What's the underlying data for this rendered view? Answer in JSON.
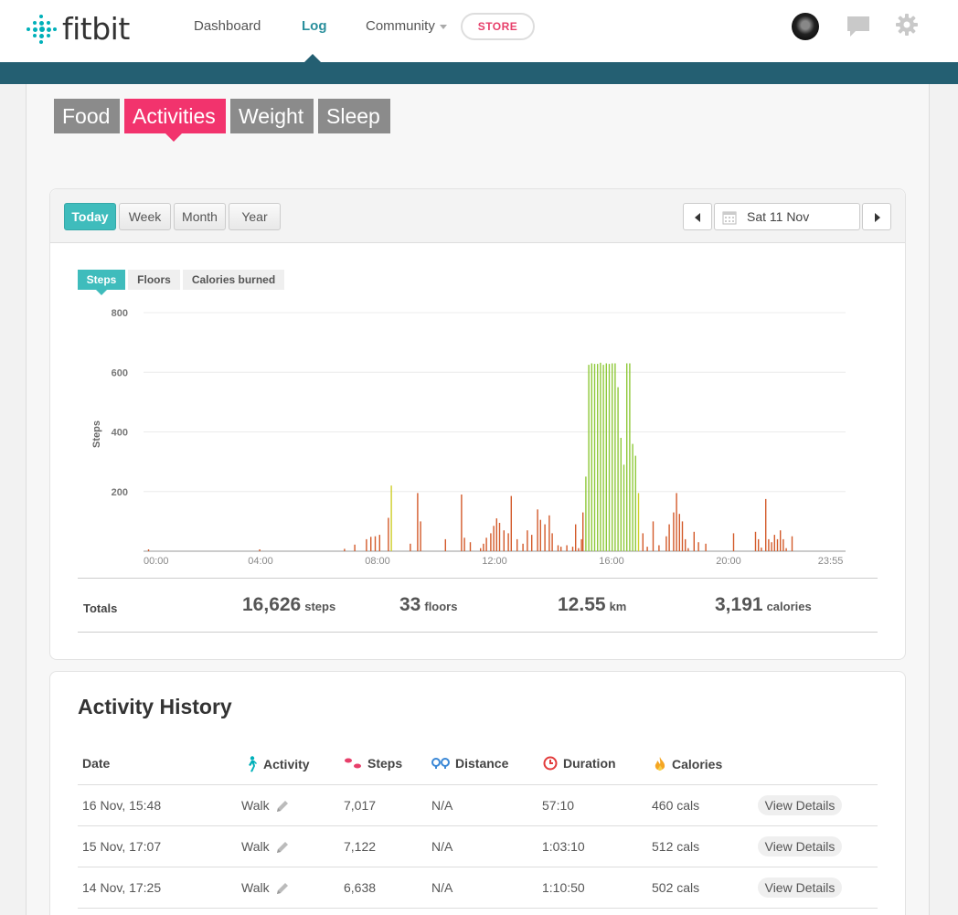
{
  "brand": {
    "name": "fitbit",
    "accent": "#00b0b9"
  },
  "nav": {
    "links": [
      "Dashboard",
      "Log",
      "Community"
    ],
    "store": "STORE",
    "icons": [
      "avatar",
      "chat-icon",
      "gear-icon"
    ]
  },
  "log_tabs": [
    "Food",
    "Activities",
    "Weight",
    "Sleep"
  ],
  "range_tabs": [
    "Today",
    "Week",
    "Month",
    "Year"
  ],
  "date_picker": {
    "value": "Sat 11 Nov"
  },
  "metric_tabs": [
    "Steps",
    "Floors",
    "Calories burned"
  ],
  "chart_data": {
    "type": "bar",
    "ylabel": "Steps",
    "ylim": [
      0,
      800
    ],
    "yticks": [
      "200",
      "400",
      "600",
      "800"
    ],
    "xticks": [
      "00:00",
      "04:00",
      "08:00",
      "12:00",
      "16:00",
      "20:00",
      "23:55"
    ],
    "colors": {
      "low": "#d35a2a",
      "mid": "#cfcf2a",
      "high": "#8fc93a"
    },
    "bars_time_value": [
      [
        0.15,
        6
      ],
      [
        3.95,
        6
      ],
      [
        6.85,
        8
      ],
      [
        7.2,
        22
      ],
      [
        7.6,
        40
      ],
      [
        7.75,
        48
      ],
      [
        7.9,
        50
      ],
      [
        8.05,
        55
      ],
      [
        8.35,
        112
      ],
      [
        8.45,
        220
      ],
      [
        9.1,
        25
      ],
      [
        9.35,
        195
      ],
      [
        9.45,
        100
      ],
      [
        10.3,
        40
      ],
      [
        10.85,
        190
      ],
      [
        10.95,
        45
      ],
      [
        11.15,
        30
      ],
      [
        11.5,
        10
      ],
      [
        11.6,
        25
      ],
      [
        11.7,
        45
      ],
      [
        11.85,
        60
      ],
      [
        11.95,
        85
      ],
      [
        12.05,
        110
      ],
      [
        12.15,
        95
      ],
      [
        12.3,
        70
      ],
      [
        12.45,
        60
      ],
      [
        12.55,
        185
      ],
      [
        12.75,
        40
      ],
      [
        12.95,
        25
      ],
      [
        13.1,
        70
      ],
      [
        13.25,
        55
      ],
      [
        13.45,
        140
      ],
      [
        13.55,
        105
      ],
      [
        13.7,
        90
      ],
      [
        13.85,
        120
      ],
      [
        13.95,
        60
      ],
      [
        14.15,
        20
      ],
      [
        14.25,
        15
      ],
      [
        14.45,
        20
      ],
      [
        14.65,
        15
      ],
      [
        14.75,
        90
      ],
      [
        14.85,
        10
      ],
      [
        14.95,
        40
      ],
      [
        15.0,
        130
      ],
      [
        15.1,
        250
      ],
      [
        15.2,
        625
      ],
      [
        15.3,
        630
      ],
      [
        15.4,
        628
      ],
      [
        15.5,
        628
      ],
      [
        15.6,
        632
      ],
      [
        15.7,
        625
      ],
      [
        15.8,
        630
      ],
      [
        15.9,
        628
      ],
      [
        16.0,
        630
      ],
      [
        16.1,
        630
      ],
      [
        16.2,
        550
      ],
      [
        16.3,
        380
      ],
      [
        16.4,
        290
      ],
      [
        16.5,
        630
      ],
      [
        16.6,
        630
      ],
      [
        16.7,
        360
      ],
      [
        16.8,
        320
      ],
      [
        16.9,
        195
      ],
      [
        17.05,
        60
      ],
      [
        17.2,
        15
      ],
      [
        17.4,
        100
      ],
      [
        17.6,
        20
      ],
      [
        17.85,
        50
      ],
      [
        17.95,
        90
      ],
      [
        18.1,
        130
      ],
      [
        18.2,
        195
      ],
      [
        18.3,
        125
      ],
      [
        18.4,
        100
      ],
      [
        18.5,
        40
      ],
      [
        18.6,
        10
      ],
      [
        18.8,
        65
      ],
      [
        18.95,
        30
      ],
      [
        19.2,
        25
      ],
      [
        20.15,
        60
      ],
      [
        20.9,
        65
      ],
      [
        21.0,
        40
      ],
      [
        21.1,
        12
      ],
      [
        21.25,
        175
      ],
      [
        21.35,
        40
      ],
      [
        21.45,
        30
      ],
      [
        21.55,
        55
      ],
      [
        21.65,
        40
      ],
      [
        21.75,
        70
      ],
      [
        21.85,
        40
      ],
      [
        21.95,
        10
      ],
      [
        22.15,
        50
      ]
    ]
  },
  "totals": {
    "label": "Totals",
    "steps": {
      "value": "16,626",
      "unit": "steps"
    },
    "floors": {
      "value": "33",
      "unit": "floors"
    },
    "distance": {
      "value": "12.55",
      "unit": "km"
    },
    "calories": {
      "value": "3,191",
      "unit": "calories"
    }
  },
  "history": {
    "title": "Activity History",
    "columns": [
      "Date",
      "Activity",
      "Steps",
      "Distance",
      "Duration",
      "Calories"
    ],
    "view_label": "View Details",
    "rows": [
      {
        "date": "16 Nov, 15:48",
        "activity": "Walk",
        "steps": "7,017",
        "distance": "N/A",
        "duration": "57:10",
        "calories": "460 cals"
      },
      {
        "date": "15 Nov, 17:07",
        "activity": "Walk",
        "steps": "7,122",
        "distance": "N/A",
        "duration": "1:03:10",
        "calories": "512 cals"
      },
      {
        "date": "14 Nov, 17:25",
        "activity": "Walk",
        "steps": "6,638",
        "distance": "N/A",
        "duration": "1:10:50",
        "calories": "502 cals"
      }
    ]
  }
}
